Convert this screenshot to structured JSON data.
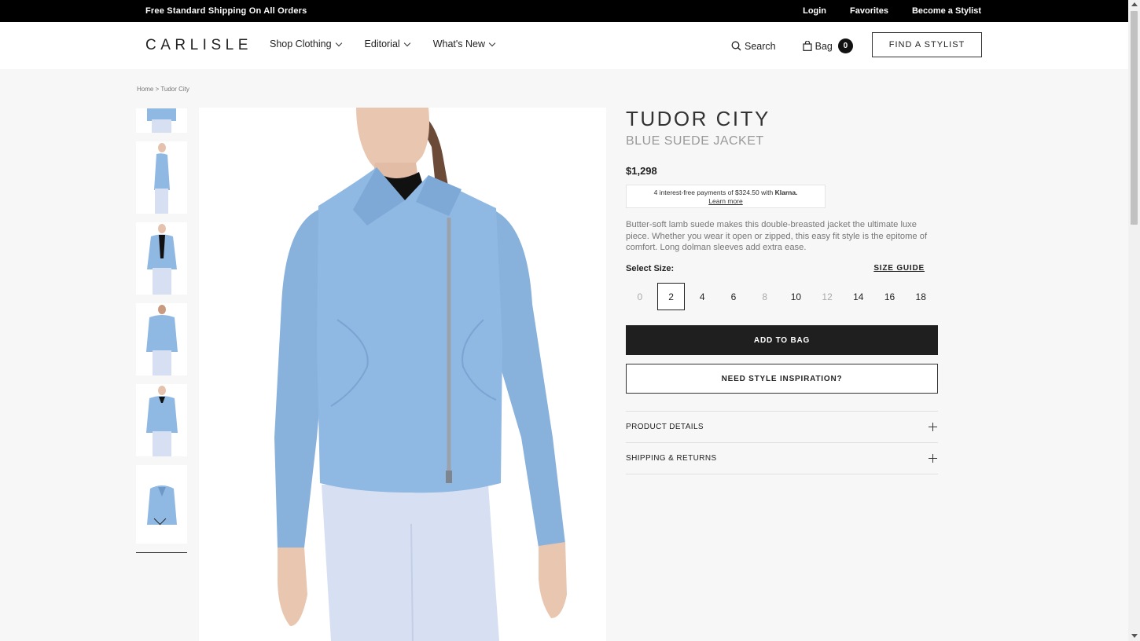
{
  "promo": {
    "shipping": "Free Standard Shipping On All Orders",
    "links": [
      "Login",
      "Favorites",
      "Become a Stylist"
    ]
  },
  "header": {
    "logo": "CARLISLE",
    "nav": [
      "Shop Clothing",
      "Editorial",
      "What's New"
    ],
    "search_label": "Search",
    "bag_label": "Bag",
    "bag_count": "0",
    "stylist_button": "FIND A STYLIST"
  },
  "breadcrumb": "Home > Tudor City",
  "product": {
    "title": "TUDOR CITY",
    "subtitle": "BLUE SUEDE JACKET",
    "price": "$1,298",
    "klarna_text": "4 interest-free payments of $324.50 with",
    "klarna_brand": "Klarna.",
    "klarna_learn": "Learn more",
    "description": "Butter-soft lamb suede makes this double-breasted jacket the ultimate luxe piece. Whether you wear it open or zipped, this easy fit style is the epitome of comfort. Long dolman sleeves add extra ease.",
    "size_label": "Select Size:",
    "size_guide": "SIZE GUIDE",
    "sizes": [
      "0",
      "2",
      "4",
      "6",
      "8",
      "10",
      "12",
      "14",
      "16",
      "18"
    ],
    "add_to_bag": "ADD TO BAG",
    "inspiration": "NEED STYLE INSPIRATION?",
    "accordion": [
      "PRODUCT DETAILS",
      "SHIPPING & RETURNS"
    ]
  },
  "colors": {
    "jacket": "#8fb8e3",
    "pants": "#d7e0f3",
    "accent": "#1f1f1f"
  }
}
